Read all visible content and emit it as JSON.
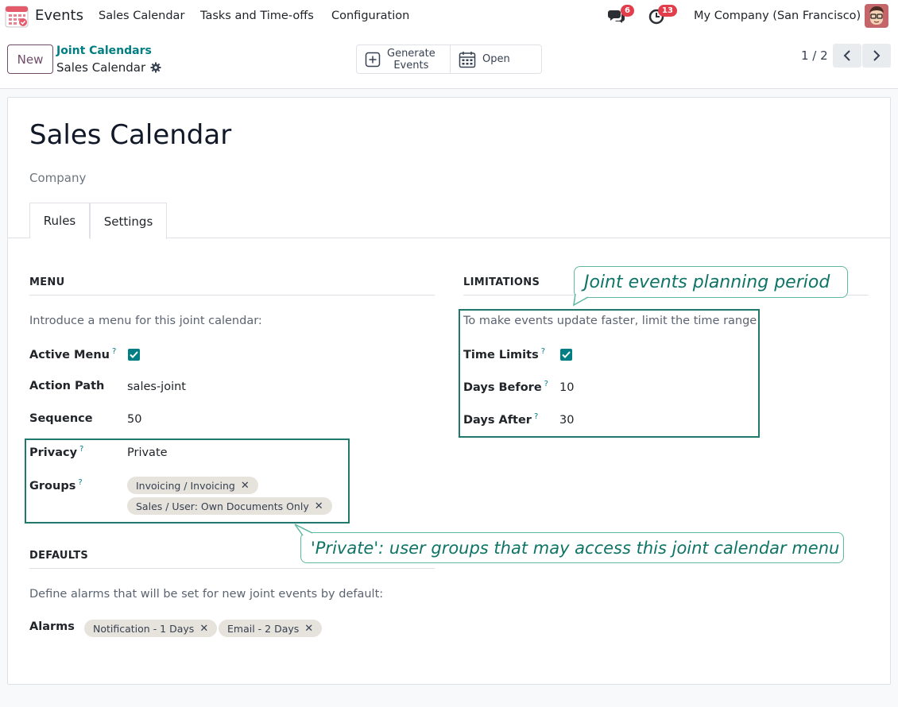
{
  "navbar": {
    "app_name": "Events",
    "menus": [
      "Sales Calendar",
      "Tasks and Time-offs",
      "Configuration"
    ],
    "messages_count": "6",
    "activities_count": "13",
    "company": "My Company (San Francisco)"
  },
  "control_panel": {
    "new_label": "New",
    "breadcrumb_parent": "Joint Calendars",
    "breadcrumb_current": "Sales Calendar",
    "generate_line1": "Generate",
    "generate_line2": "Events",
    "open_label": "Open",
    "pager": "1 / 2"
  },
  "form": {
    "title": "Sales Calendar",
    "company_placeholder": "Company",
    "tabs": [
      "Rules",
      "Settings"
    ],
    "active_tab": "Settings",
    "menu": {
      "heading": "MENU",
      "intro": "Introduce a menu for this joint calendar:",
      "active_menu_label": "Active Menu",
      "active_menu_checked": true,
      "action_path_label": "Action Path",
      "action_path_value": "sales-joint",
      "sequence_label": "Sequence",
      "sequence_value": "50",
      "privacy_label": "Privacy",
      "privacy_value": "Private",
      "groups_label": "Groups",
      "groups": [
        "Invoicing / Invoicing",
        "Sales / User: Own Documents Only"
      ]
    },
    "limitations": {
      "heading": "LIMITATIONS",
      "intro": "To make events update faster, limit the time range:",
      "time_limits_label": "Time Limits",
      "time_limits_checked": true,
      "days_before_label": "Days Before",
      "days_before_value": "10",
      "days_after_label": "Days After",
      "days_after_value": "30"
    },
    "defaults": {
      "heading": "DEFAULTS",
      "intro": "Define alarms that will be set for new joint events by default:",
      "alarms_label": "Alarms",
      "alarms": [
        "Notification - 1 Days",
        "Email - 2 Days"
      ]
    }
  },
  "annotations": {
    "planning_period": "Joint events planning period",
    "private_note": "'Private': user groups that may access this joint calendar menu"
  },
  "colors": {
    "accent": "#017e84",
    "brand": "#714b67",
    "annotation": "#1f7a6d",
    "badge": "#e23d4b"
  },
  "help_mark": "?",
  "tag_remove": "✕"
}
